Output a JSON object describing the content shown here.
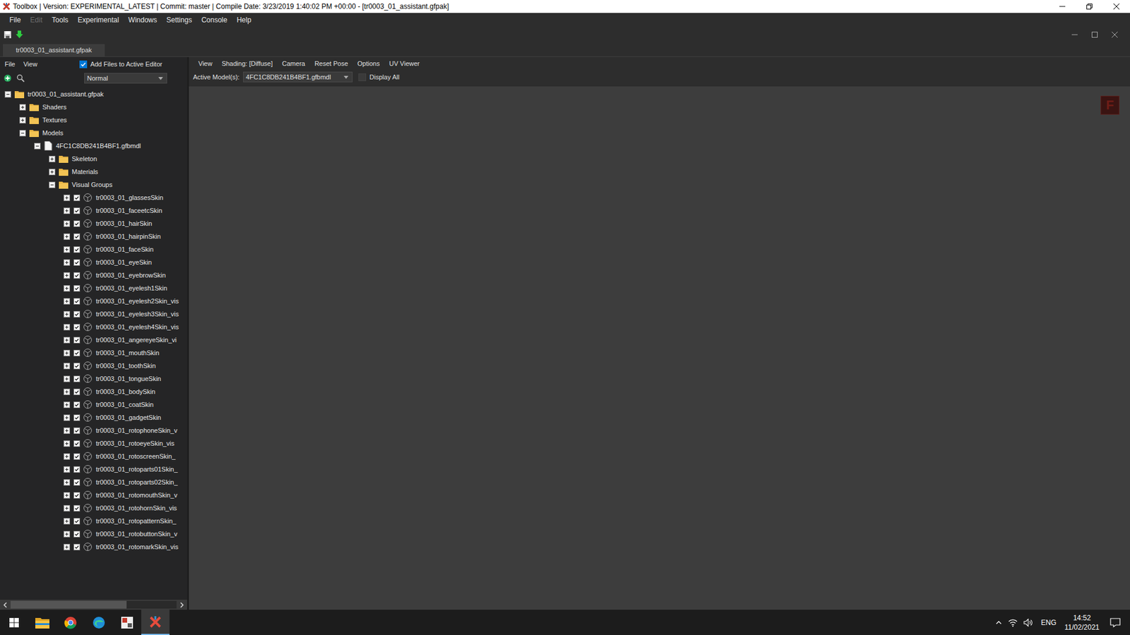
{
  "window": {
    "title": "Toolbox | Version: EXPERIMENTAL_LATEST | Commit: master | Compile Date: 3/23/2019 1:40:02 PM +00:00 - [tr0003_01_assistant.gfpak]"
  },
  "menu": [
    {
      "label": "File",
      "disabled": false
    },
    {
      "label": "Edit",
      "disabled": true
    },
    {
      "label": "Tools",
      "disabled": false
    },
    {
      "label": "Experimental",
      "disabled": false
    },
    {
      "label": "Windows",
      "disabled": false
    },
    {
      "label": "Settings",
      "disabled": false
    },
    {
      "label": "Console",
      "disabled": false
    },
    {
      "label": "Help",
      "disabled": false
    }
  ],
  "tabs": [
    {
      "label": "tr0003_01_assistant.gfpak",
      "selected": true
    }
  ],
  "explorer": {
    "menu": [
      "File",
      "View"
    ],
    "add_files": {
      "label": "Add Files to Active Editor",
      "checked": true
    },
    "mode": "Normal",
    "tree": [
      {
        "label": "tr0003_01_assistant.gfpak",
        "depth": 0,
        "kind": "folder",
        "expanded": true
      },
      {
        "label": "Shaders",
        "depth": 1,
        "kind": "folder",
        "expanded": false
      },
      {
        "label": "Textures",
        "depth": 1,
        "kind": "folder",
        "expanded": false
      },
      {
        "label": "Models",
        "depth": 1,
        "kind": "folder",
        "expanded": true
      },
      {
        "label": "4FC1C8DB241B4BF1.gfbmdl",
        "depth": 2,
        "kind": "file",
        "expanded": true
      },
      {
        "label": "Skeleton",
        "depth": 3,
        "kind": "folder",
        "expanded": false
      },
      {
        "label": "Materials",
        "depth": 3,
        "kind": "folder",
        "expanded": false
      },
      {
        "label": "Visual Groups",
        "depth": 3,
        "kind": "folder",
        "expanded": true
      },
      {
        "label": "tr0003_01_glassesSkin",
        "depth": 4,
        "kind": "mesh",
        "expanded": false,
        "checked": true
      },
      {
        "label": "tr0003_01_faceetcSkin",
        "depth": 4,
        "kind": "mesh",
        "expanded": false,
        "checked": true
      },
      {
        "label": "tr0003_01_hairSkin",
        "depth": 4,
        "kind": "mesh",
        "expanded": false,
        "checked": true
      },
      {
        "label": "tr0003_01_hairpinSkin",
        "depth": 4,
        "kind": "mesh",
        "expanded": false,
        "checked": true
      },
      {
        "label": "tr0003_01_faceSkin",
        "depth": 4,
        "kind": "mesh",
        "expanded": false,
        "checked": true
      },
      {
        "label": "tr0003_01_eyeSkin",
        "depth": 4,
        "kind": "mesh",
        "expanded": false,
        "checked": true
      },
      {
        "label": "tr0003_01_eyebrowSkin",
        "depth": 4,
        "kind": "mesh",
        "expanded": false,
        "checked": true
      },
      {
        "label": "tr0003_01_eyelesh1Skin",
        "depth": 4,
        "kind": "mesh",
        "expanded": false,
        "checked": true
      },
      {
        "label": "tr0003_01_eyelesh2Skin_vis",
        "depth": 4,
        "kind": "mesh",
        "expanded": false,
        "checked": true
      },
      {
        "label": "tr0003_01_eyelesh3Skin_vis",
        "depth": 4,
        "kind": "mesh",
        "expanded": false,
        "checked": true
      },
      {
        "label": "tr0003_01_eyelesh4Skin_vis",
        "depth": 4,
        "kind": "mesh",
        "expanded": false,
        "checked": true
      },
      {
        "label": "tr0003_01_angereyeSkin_vi",
        "depth": 4,
        "kind": "mesh",
        "expanded": false,
        "checked": true
      },
      {
        "label": "tr0003_01_mouthSkin",
        "depth": 4,
        "kind": "mesh",
        "expanded": false,
        "checked": true
      },
      {
        "label": "tr0003_01_toothSkin",
        "depth": 4,
        "kind": "mesh",
        "expanded": false,
        "checked": true
      },
      {
        "label": "tr0003_01_tongueSkin",
        "depth": 4,
        "kind": "mesh",
        "expanded": false,
        "checked": true
      },
      {
        "label": "tr0003_01_bodySkin",
        "depth": 4,
        "kind": "mesh",
        "expanded": false,
        "checked": true
      },
      {
        "label": "tr0003_01_coatSkin",
        "depth": 4,
        "kind": "mesh",
        "expanded": false,
        "checked": true
      },
      {
        "label": "tr0003_01_gadgetSkin",
        "depth": 4,
        "kind": "mesh",
        "expanded": false,
        "checked": true
      },
      {
        "label": "tr0003_01_rotophoneSkin_v",
        "depth": 4,
        "kind": "mesh",
        "expanded": false,
        "checked": true
      },
      {
        "label": "tr0003_01_rotoeyeSkin_vis",
        "depth": 4,
        "kind": "mesh",
        "expanded": false,
        "checked": true
      },
      {
        "label": "tr0003_01_rotoscreenSkin_",
        "depth": 4,
        "kind": "mesh",
        "expanded": false,
        "checked": true
      },
      {
        "label": "tr0003_01_rotoparts01Skin_",
        "depth": 4,
        "kind": "mesh",
        "expanded": false,
        "checked": true
      },
      {
        "label": "tr0003_01_rotoparts02Skin_",
        "depth": 4,
        "kind": "mesh",
        "expanded": false,
        "checked": true
      },
      {
        "label": "tr0003_01_rotomouthSkin_v",
        "depth": 4,
        "kind": "mesh",
        "expanded": false,
        "checked": true
      },
      {
        "label": "tr0003_01_rotohornSkin_vis",
        "depth": 4,
        "kind": "mesh",
        "expanded": false,
        "checked": true
      },
      {
        "label": "tr0003_01_rotopatternSkin_",
        "depth": 4,
        "kind": "mesh",
        "expanded": false,
        "checked": true
      },
      {
        "label": "tr0003_01_rotobuttonSkin_v",
        "depth": 4,
        "kind": "mesh",
        "expanded": false,
        "checked": true
      },
      {
        "label": "tr0003_01_rotomarkSkin_vis",
        "depth": 4,
        "kind": "mesh",
        "expanded": false,
        "checked": true
      }
    ]
  },
  "viewport": {
    "menu": [
      "View",
      "Shading: [Diffuse]",
      "Camera",
      "Reset Pose",
      "Options",
      "UV Viewer"
    ],
    "active_label": "Active Model(s):",
    "active_model": "4FC1C8DB241B4BF1.gfbmdl",
    "display_all": {
      "label": "Display All",
      "checked": false
    },
    "badge": "F"
  },
  "taskbar": {
    "apps": [
      {
        "kind": "explorer",
        "active": false
      },
      {
        "kind": "chrome",
        "active": false
      },
      {
        "kind": "edge",
        "active": false
      },
      {
        "kind": "app",
        "active": false
      },
      {
        "kind": "toolbox",
        "active": true
      }
    ],
    "language": "ENG",
    "time": "14:52",
    "date": "11/02/2021"
  }
}
